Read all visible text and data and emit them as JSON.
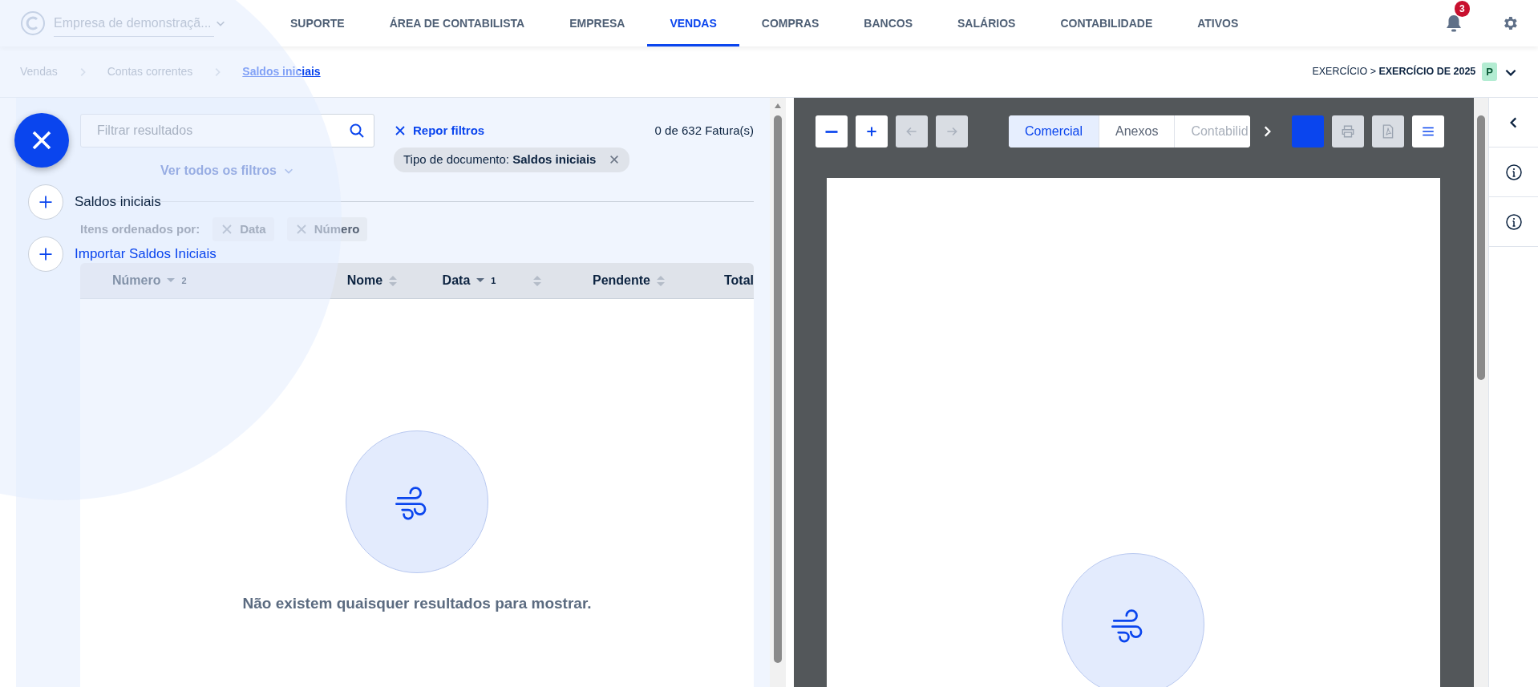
{
  "header": {
    "company": "Empresa de demonstraçã...",
    "notifications": "3",
    "nav": [
      {
        "label": "SUPORTE",
        "selected": false
      },
      {
        "label": "ÁREA DE CONTABILISTA",
        "selected": false
      },
      {
        "label": "EMPRESA",
        "selected": false
      },
      {
        "label": "VENDAS",
        "selected": true
      },
      {
        "label": "COMPRAS",
        "selected": false
      },
      {
        "label": "BANCOS",
        "selected": false
      },
      {
        "label": "SALÁRIOS",
        "selected": false
      },
      {
        "label": "CONTABILIDADE",
        "selected": false
      },
      {
        "label": "ATIVOS",
        "selected": false
      }
    ]
  },
  "breadcrumb": [
    {
      "label": "Vendas",
      "current": false
    },
    {
      "label": "Contas correntes",
      "current": false
    },
    {
      "label": "Saldos iniciais",
      "current": true
    }
  ],
  "fiscal_year": {
    "label": "EXERCÍCIO >",
    "value": "EXERCÍCIO DE 2025",
    "status": "P"
  },
  "filters": {
    "placeholder": "Filtrar resultados",
    "reset": "Repor filtros",
    "count": "0 de 632 Fatura(s)",
    "more": "Ver todos os filtros",
    "chips": [
      {
        "label": "Tipo de documento:",
        "value": "Saldos iniciais"
      }
    ]
  },
  "sort": {
    "label": "Itens ordenados por:",
    "items": [
      {
        "label": "Data"
      },
      {
        "label": "Número"
      }
    ]
  },
  "table": {
    "columns": [
      {
        "label": "Número",
        "sortable": true,
        "sorted": true,
        "order": "2"
      },
      {
        "label": "Nome",
        "sortable": true,
        "sorted": false
      },
      {
        "label": "Data",
        "sortable": true,
        "sorted": true,
        "order": "1"
      },
      {
        "sortable": true,
        "sorted": false
      },
      {
        "label": "Pendente",
        "sortable": true,
        "sorted": false
      },
      {
        "label": "Total",
        "sortable": false
      }
    ],
    "empty_message": "Não existem quaisquer resultados para mostrar."
  },
  "viewer": {
    "tools": [
      {
        "kind": "zoom-out",
        "disabled": false
      },
      {
        "kind": "zoom-in",
        "disabled": false
      },
      {
        "kind": "previous",
        "disabled": true
      },
      {
        "kind": "next",
        "disabled": true
      }
    ],
    "tabs": [
      {
        "label": "Comercial",
        "selected": true
      },
      {
        "label": "Anexos",
        "selected": false
      },
      {
        "label": "Contabilid",
        "selected": false
      }
    ],
    "actions": [
      {
        "kind": "color"
      },
      {
        "kind": "print",
        "disabled": true
      },
      {
        "kind": "pdf",
        "disabled": true
      },
      {
        "kind": "menu",
        "disabled": false
      }
    ]
  },
  "rail": [
    {
      "kind": "collapse"
    },
    {
      "kind": "info"
    },
    {
      "kind": "info"
    }
  ],
  "fab_menu": {
    "open": true,
    "items": [
      {
        "label": "Saldos iniciais",
        "highlighted": false
      },
      {
        "label": "Importar Saldos Iniciais",
        "highlighted": true
      }
    ]
  }
}
